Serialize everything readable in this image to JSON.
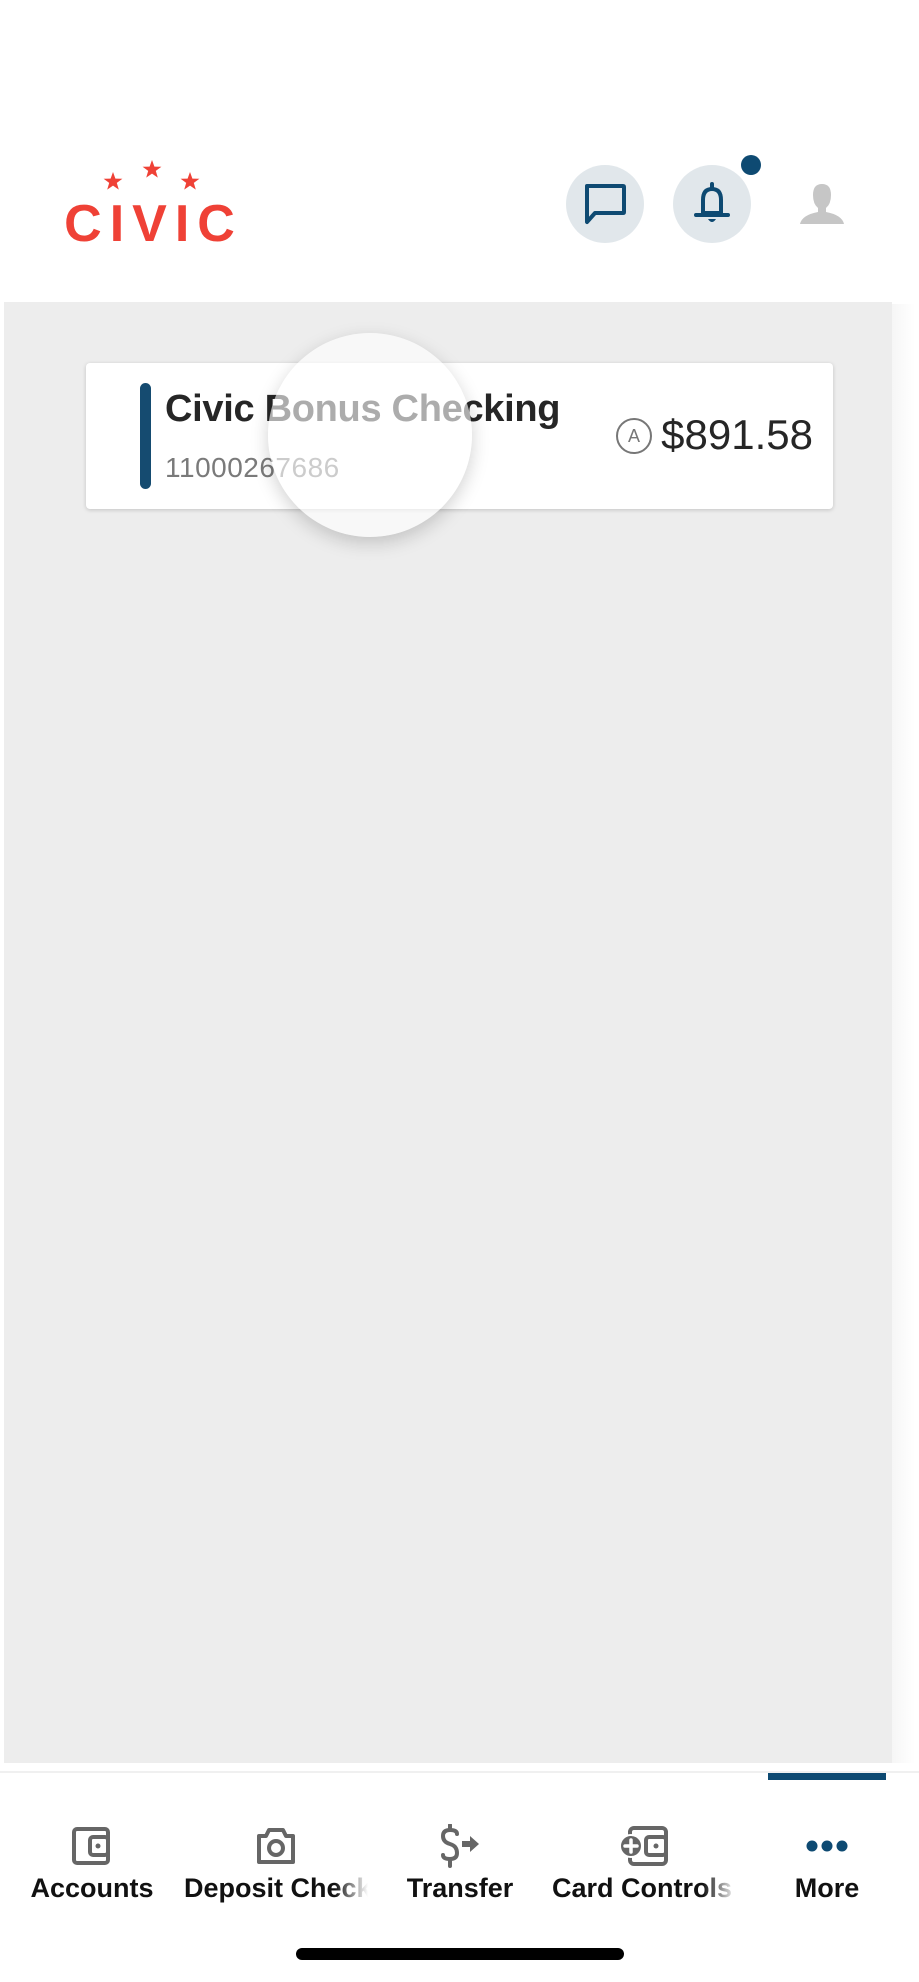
{
  "header": {
    "logo_text": "CIVIC",
    "brand_color": "#ef4136",
    "icons": {
      "chat": "chat-icon",
      "notifications": "bell-icon",
      "profile": "person-icon"
    },
    "notification_badge": true
  },
  "accounts": [
    {
      "name": "Civic Bonus Checking",
      "number": "11000267686",
      "balance_indicator": "A",
      "balance": "$891.58",
      "accent_color": "#154b70"
    }
  ],
  "tabbar": {
    "active_index": 4,
    "active_color": "#0e4a72",
    "tabs": [
      {
        "label": "Accounts",
        "icon": "wallet-icon"
      },
      {
        "label": "Deposit Check",
        "icon": "camera-icon"
      },
      {
        "label": "Transfer",
        "icon": "dollar-transfer-icon"
      },
      {
        "label": "Card Controls",
        "icon": "card-control-icon"
      },
      {
        "label": "More",
        "icon": "more-dots-icon"
      }
    ]
  }
}
